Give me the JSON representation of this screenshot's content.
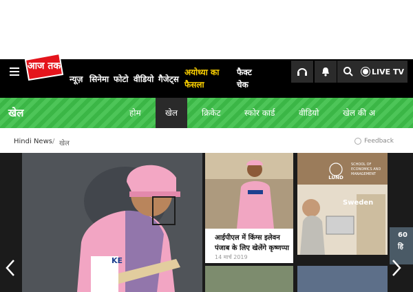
{
  "header": {
    "logo_text": "आज तक",
    "nav": [
      "न्यूज़",
      "सिनेमा",
      "फोटो",
      "वीडियो",
      "गैजेट्स"
    ],
    "highlight_nav": [
      "अयोध्या का",
      "फैसला"
    ],
    "fact_check": [
      "फैक्ट",
      "चेक"
    ],
    "live_label": "LIVE TV",
    "icons": [
      "headphones-icon",
      "bell-icon",
      "search-icon",
      "live-dot-icon"
    ]
  },
  "section": {
    "title": "खेल",
    "tabs": [
      "होम",
      "खेल",
      "क्रिकेट",
      "स्कोर कार्ड",
      "वीडियो",
      "खेल की अ"
    ],
    "active_tab": "खेल"
  },
  "breadcrumb": {
    "home": "Hindi News",
    "separator": "/",
    "current": "खेल",
    "feedback": "Feedback"
  },
  "cards": [
    {
      "title": "आईपीएल में किंग्स इलेवन पंजाब के लिए खेलेंगे कृष्णप्पा",
      "date": "14 मार्च 2019"
    },
    {
      "ad_brand": "LUND",
      "ad_text": "SCHOOL OF ECONOMICS AND MANAGEMENT",
      "ad_country": "Sweden"
    }
  ],
  "partial_card_text": [
    "60",
    "हि"
  ],
  "colors": {
    "accent_red": "#e4141c",
    "section_green": "#3ec04a",
    "nav_black": "#000000",
    "highlight_yellow": "#ffd300"
  }
}
